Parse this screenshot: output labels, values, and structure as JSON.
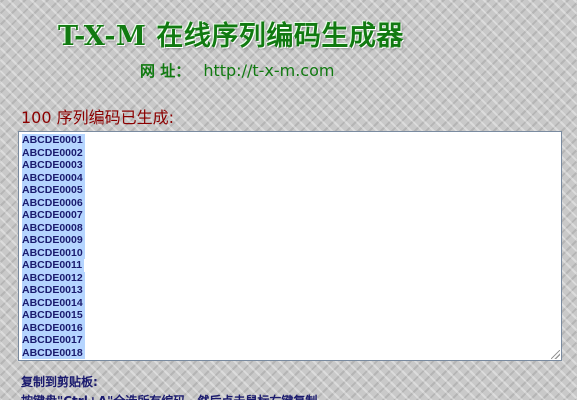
{
  "header": {
    "title": "T-X-M 在线序列编码生成器",
    "website_label": "网 址：",
    "website_url": "http://t-x-m.com"
  },
  "main": {
    "status": "100 序列编码已生成:",
    "codes": [
      "ABCDE0001",
      "ABCDE0002",
      "ABCDE0003",
      "ABCDE0004",
      "ABCDE0005",
      "ABCDE0006",
      "ABCDE0007",
      "ABCDE0008",
      "ABCDE0009",
      "ABCDE0010",
      "ABCDE0011",
      "ABCDE0012",
      "ABCDE0013",
      "ABCDE0014",
      "ABCDE0015",
      "ABCDE0016",
      "ABCDE0017",
      "ABCDE0018"
    ]
  },
  "footer": {
    "copy_heading": "复制到剪贴板:",
    "instruction": "按键盘\"Ctrl+A\"全选所有编码，然后点击鼠标右键复制"
  },
  "colors": {
    "title_green": "#117a11",
    "status_red": "#8b0000",
    "text_navy": "#1a1a6e",
    "selection_blue": "#b5d5ff"
  }
}
